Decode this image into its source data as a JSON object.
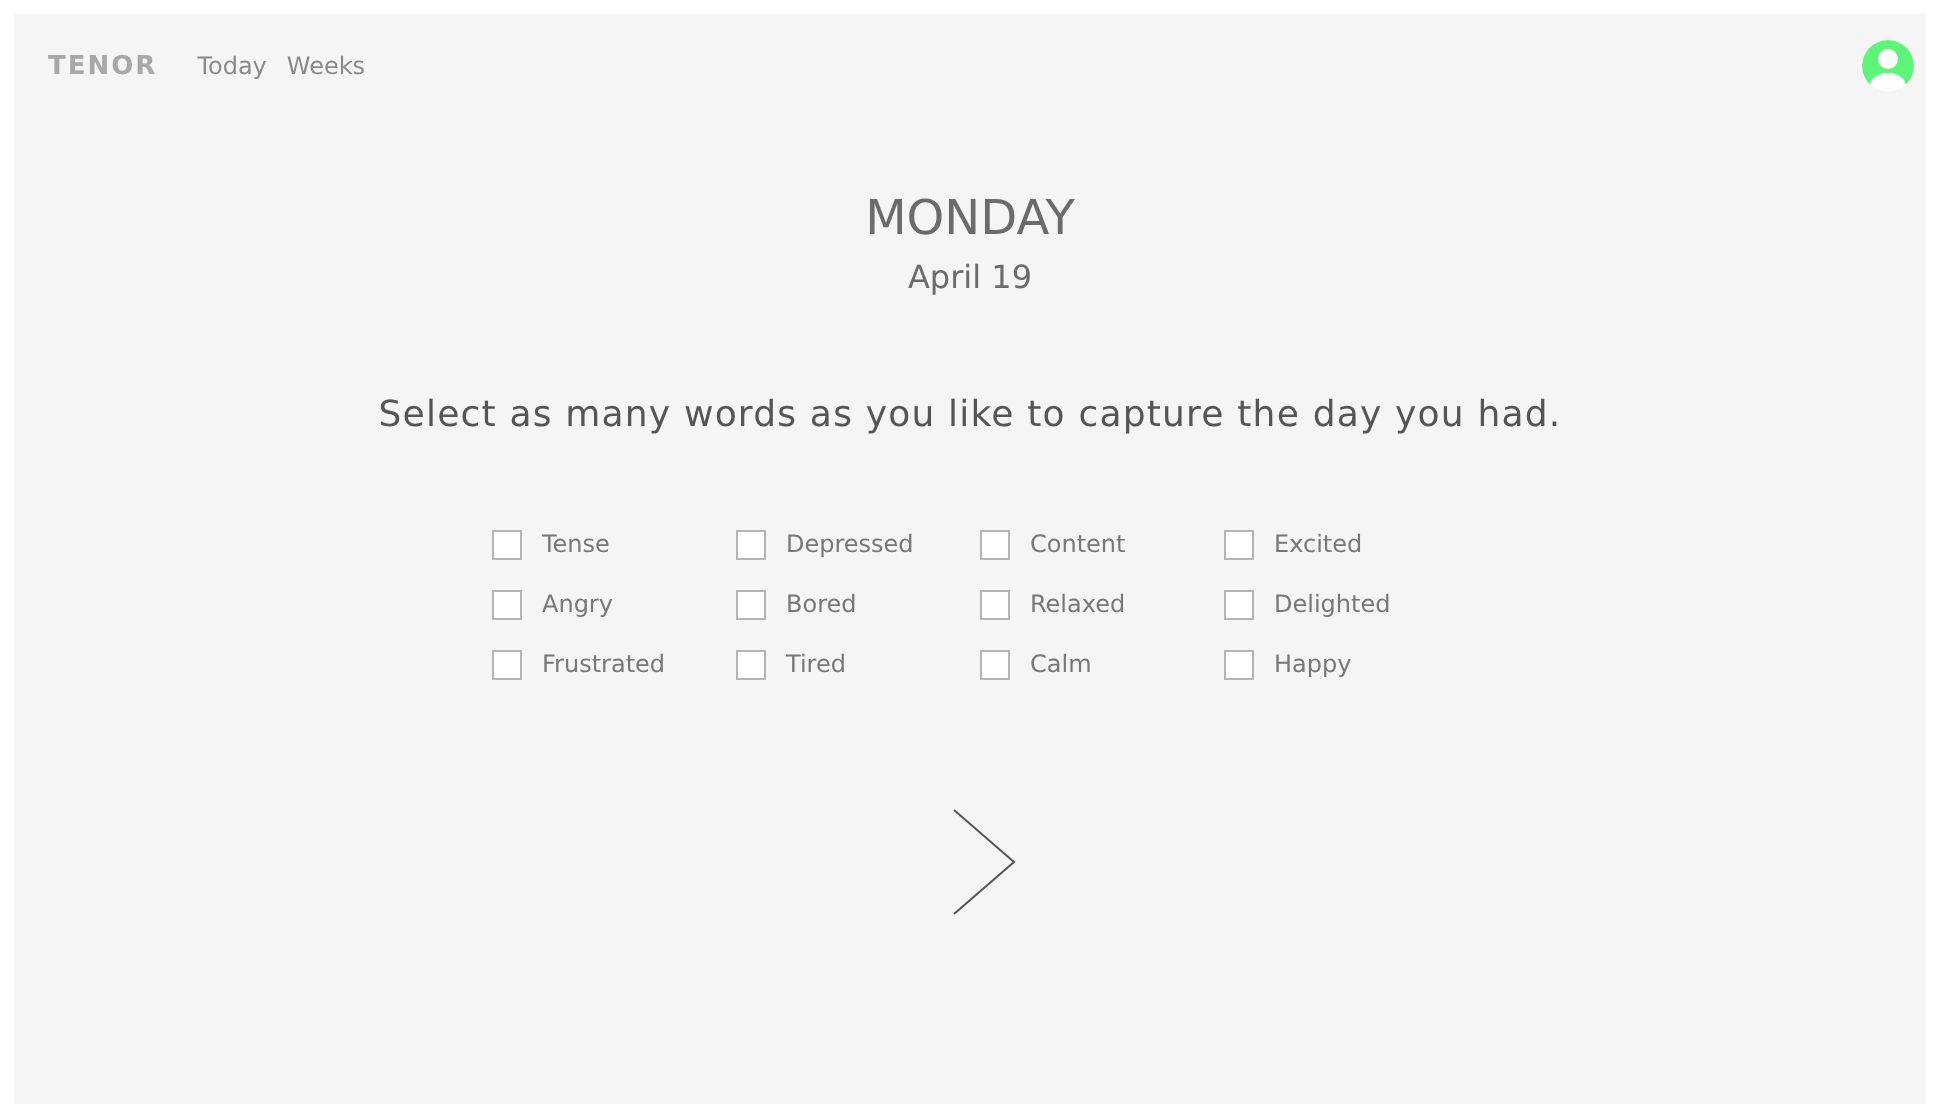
{
  "nav": {
    "logo": "TENOR",
    "links": [
      {
        "label": "Today",
        "selected": false
      },
      {
        "label": "Weeks",
        "selected": false
      }
    ]
  },
  "day": {
    "weekday": "MONDAY",
    "date": "April 19"
  },
  "prompt": "Select as many words as you like to capture the day you had.",
  "word_columns": [
    [
      {
        "label": "Tense",
        "checked": false
      },
      {
        "label": "Angry",
        "checked": false
      },
      {
        "label": "Frustrated",
        "checked": false
      }
    ],
    [
      {
        "label": "Depressed",
        "checked": false
      },
      {
        "label": "Bored",
        "checked": false
      },
      {
        "label": "Tired",
        "checked": false
      }
    ],
    [
      {
        "label": "Content",
        "checked": false
      },
      {
        "label": "Relaxed",
        "checked": false
      },
      {
        "label": "Calm",
        "checked": false
      }
    ],
    [
      {
        "label": "Excited",
        "checked": false
      },
      {
        "label": "Delighted",
        "checked": false
      },
      {
        "label": "Happy",
        "checked": false
      }
    ]
  ]
}
